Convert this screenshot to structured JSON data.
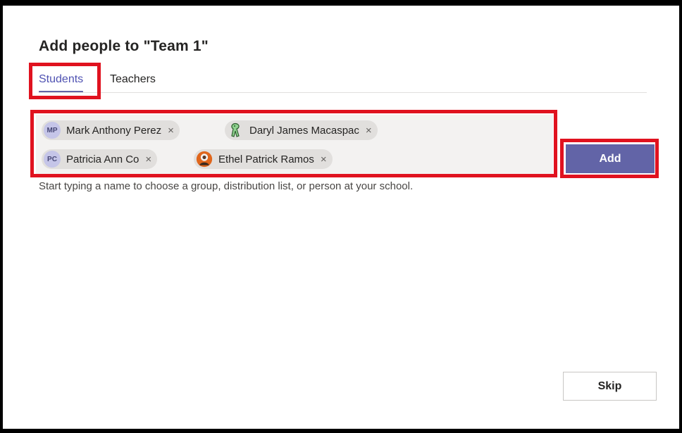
{
  "dialog": {
    "title": "Add people to \"Team 1\"",
    "tabs": [
      {
        "label": "Students",
        "selected": true
      },
      {
        "label": "Teachers",
        "selected": false
      }
    ],
    "selected_people": [
      {
        "name": "Mark Anthony Perez",
        "initials": "MP",
        "avatar": "initials",
        "remove": "×"
      },
      {
        "name": "Daryl James Macaspac",
        "initials": "",
        "avatar": "green-figure-avatar",
        "remove": "×"
      },
      {
        "name": "Patricia Ann Co",
        "initials": "PC",
        "avatar": "initials",
        "remove": "×"
      },
      {
        "name": "Ethel Patrick Ramos",
        "initials": "",
        "avatar": "orange-photo-avatar",
        "remove": "×"
      }
    ],
    "hint": "Start typing a name to choose a group, distribution list, or person at your school.",
    "add_label": "Add",
    "skip_label": "Skip"
  },
  "colors": {
    "accent": "#6264a7",
    "highlight": "#e0121f",
    "chip_bg": "#e1dfdd",
    "picker_bg": "#f3f2f1"
  }
}
